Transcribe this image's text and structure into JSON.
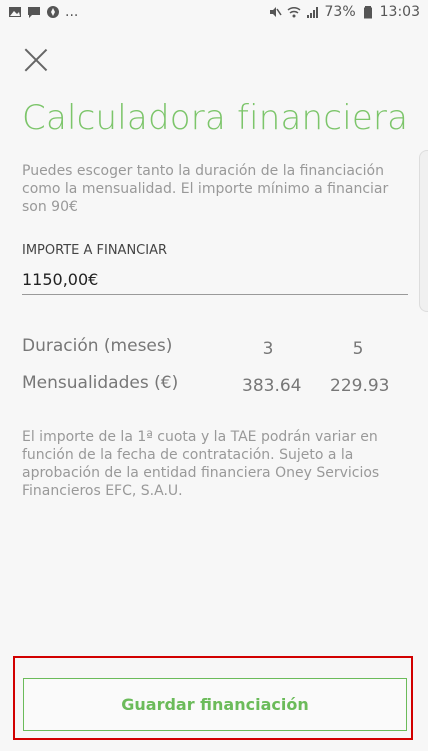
{
  "statusbar": {
    "battery": "73%",
    "time": "13:03",
    "left_icons": [
      "image-icon",
      "message-icon",
      "compass-icon"
    ],
    "right_icons": [
      "mute-icon",
      "wifi-icon",
      "signal-icon",
      "battery-icon"
    ],
    "more": "..."
  },
  "header": {
    "title": "Calculadora financiera",
    "description": "Puedes escoger tanto la duración de la financiación como la mensualidad. El importe mínimo a financiar son 90€"
  },
  "form": {
    "amount_label": "IMPORTE A FINANCIAR",
    "amount_value": "1150,00€"
  },
  "plans": {
    "duration_label": "Duración (meses)",
    "monthly_label": "Mensualidades (€)",
    "durations": [
      "3",
      "5"
    ],
    "monthly": [
      "383.64",
      "229.93"
    ]
  },
  "notes": {
    "text": "El importe de la 1ª cuota y la TAE podrán variar en función de la fecha de contratación. Sujeto a la aprobación de la entidad financiera Oney Servicios Financieros EFC, S.A.U."
  },
  "actions": {
    "save_label": "Guardar financiación"
  },
  "colors": {
    "accent": "#7cc56a",
    "button_border": "#6bbb5a",
    "highlight": "#d20000"
  }
}
